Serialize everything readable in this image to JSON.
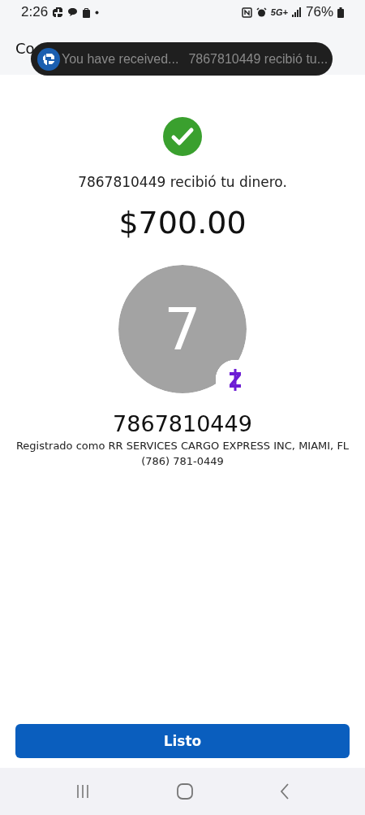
{
  "status_bar": {
    "time": "2:26",
    "network": "5G+",
    "battery": "76%"
  },
  "header": {
    "title": "Co"
  },
  "notification": {
    "title": "You have received...",
    "text": "7867810449 recibió tu..."
  },
  "confirmation": {
    "message": "7867810449 recibió tu dinero.",
    "amount": "$700.00",
    "avatar_initial": "7",
    "recipient": "7867810449",
    "registered": "Registrado como RR SERVICES CARGO EXPRESS INC, MIAMI, FL",
    "phone": "(786) 781-0449"
  },
  "done_button": "Listo"
}
